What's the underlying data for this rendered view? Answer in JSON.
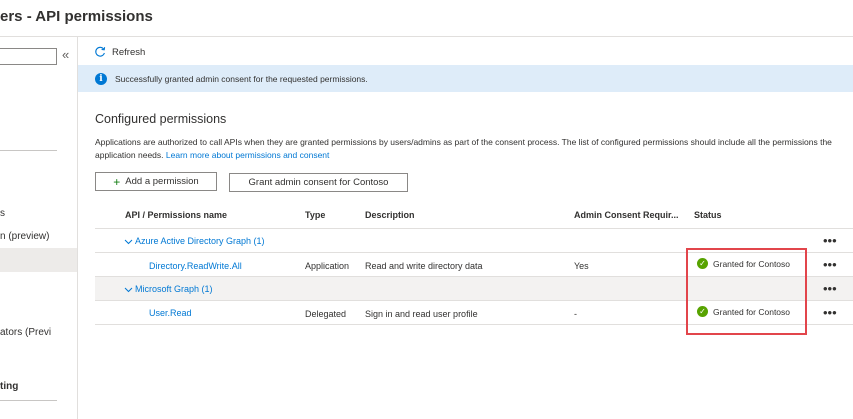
{
  "header": {
    "title": "ers - API permissions"
  },
  "sidebar": {
    "collapse_glyph": "«",
    "items": [
      {
        "label": "s"
      },
      {
        "label": "n (preview)"
      },
      {
        "label": "ators (Previ"
      },
      {
        "label": "ting"
      }
    ]
  },
  "toolbar": {
    "refresh_label": "Refresh"
  },
  "banner": {
    "message": "Successfully granted admin consent for the requested permissions."
  },
  "main": {
    "section_title": "Configured permissions",
    "description_text": "Applications are authorized to call APIs when they are granted permissions by users/admins as part of the consent process. The list of configured permissions should include all the permissions the application needs.",
    "learn_more_link": "Learn more about permissions and consent",
    "add_permission_label": "Add a permission",
    "grant_consent_label": "Grant admin consent for Contoso"
  },
  "table": {
    "headers": {
      "api": "API / Permissions name",
      "type": "Type",
      "description": "Description",
      "admin_consent": "Admin Consent Requir...",
      "status": "Status"
    },
    "groups": [
      {
        "name": "Azure Active Directory Graph (1)",
        "rows": [
          {
            "name": "Directory.ReadWrite.All",
            "type": "Application",
            "description": "Read and write directory data",
            "admin_consent": "Yes",
            "status": "Granted for Contoso"
          }
        ]
      },
      {
        "name": "Microsoft Graph (1)",
        "rows": [
          {
            "name": "User.Read",
            "type": "Delegated",
            "description": "Sign in and read user profile",
            "admin_consent": "-",
            "status": "Granted for Contoso"
          }
        ]
      }
    ],
    "more_glyph": "•••"
  },
  "colors": {
    "accent": "#0078d4",
    "success": "#57a300",
    "banner_bg": "#deecf9",
    "highlight": "#e2454b"
  },
  "icons": {
    "refresh": "refresh-icon",
    "info": "info-icon",
    "plus": "plus-icon",
    "chevron": "chevron-down-icon",
    "status_ok": "check-circle-icon",
    "more": "more-icon"
  }
}
